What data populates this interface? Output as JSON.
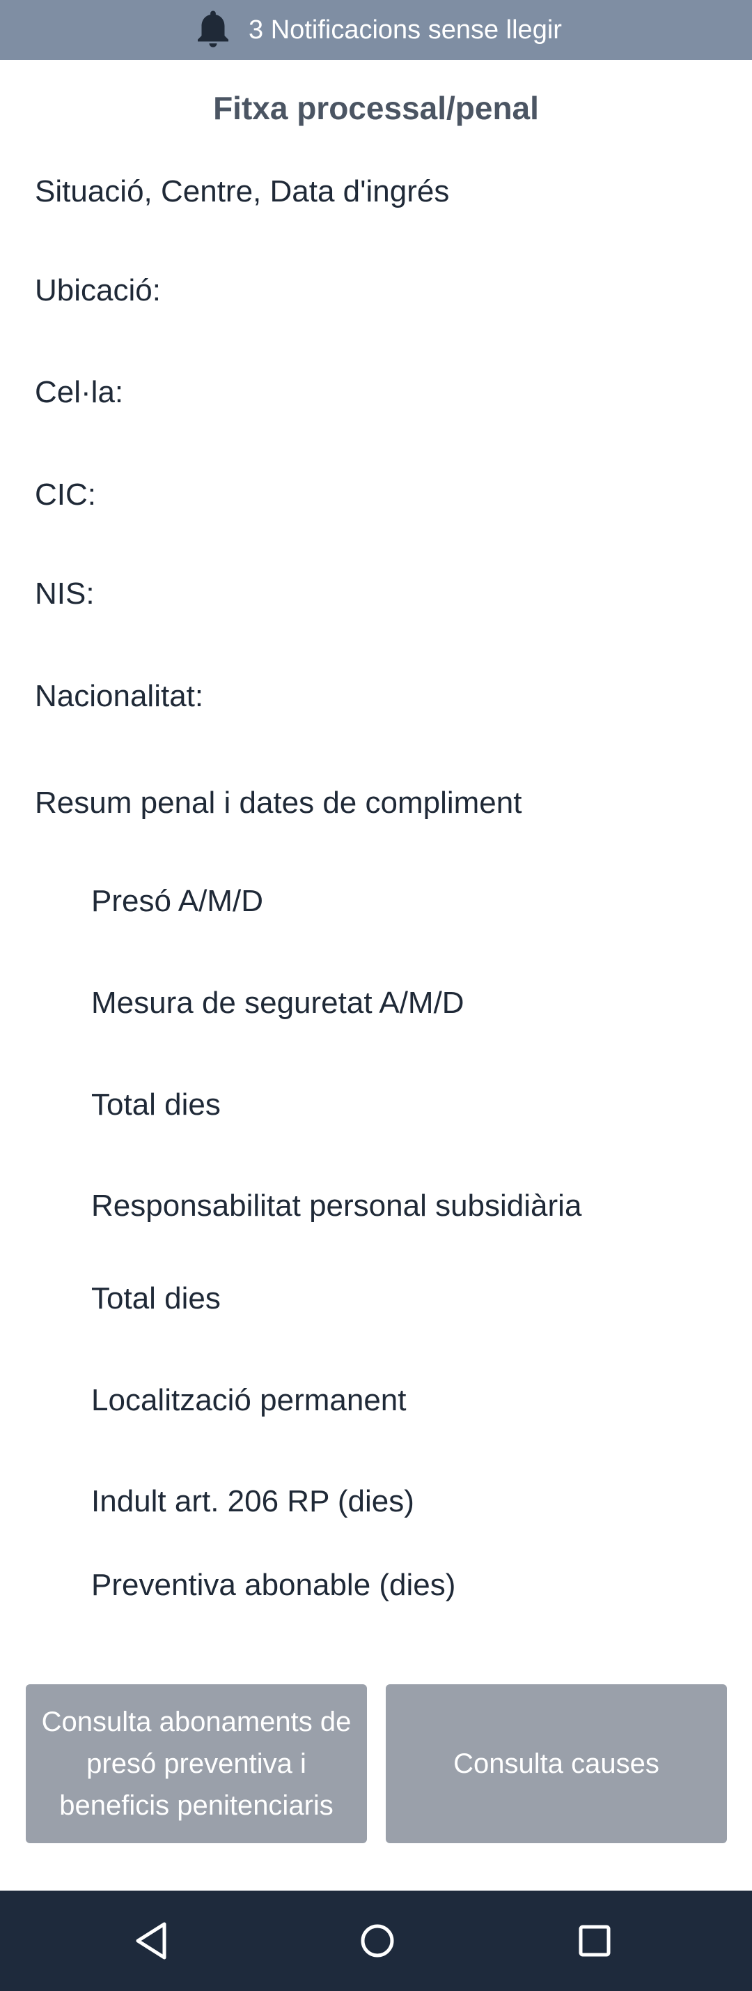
{
  "notification_bar": {
    "icon": "bell-icon",
    "text": "3 Notificacions sense llegir"
  },
  "page": {
    "title": "Fitxa processal/penal"
  },
  "info_rows": [
    "Situació, Centre, Data d'ingrés",
    "Ubicació:",
    "Cel·la:",
    "CIC:",
    "NIS:",
    "Nacionalitat:",
    "Resum penal i dates de compliment"
  ],
  "summary_rows": [
    "Presó A/M/D",
    "Mesura de seguretat A/M/D",
    "Total dies",
    "Responsabilitat personal subsidiària",
    "Total dies",
    "Localització permanent",
    "Indult art. 206 RP (dies)",
    "Preventiva abonable (dies)"
  ],
  "buttons": {
    "abonaments": "Consulta abonaments de presó preventiva i beneficis penitenciaris",
    "causes": "Consulta causes"
  },
  "navbar": {
    "back_icon": "back-triangle-icon",
    "home_icon": "home-circle-icon",
    "recents_icon": "recents-square-icon"
  },
  "colors": {
    "notification_bg": "#7f8ea3",
    "button_bg": "#9aa0aa",
    "navbar_bg": "#1e2a3c"
  }
}
